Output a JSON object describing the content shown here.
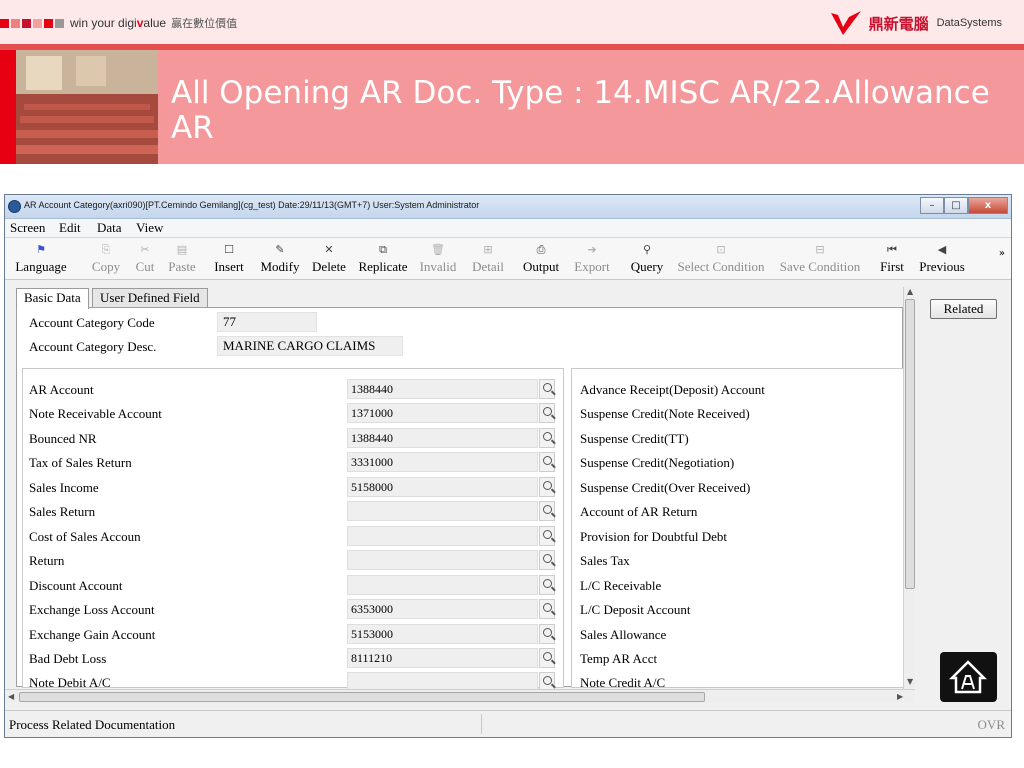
{
  "slide": {
    "tagline_en_1": "win your digi",
    "tagline_en_v": "v",
    "tagline_en_2": "alue",
    "tagline_zh": "贏在數位價值",
    "brand_zh": "鼎新電腦",
    "brand_en": "DataSystems",
    "title": "All Opening AR Doc. Type : 14.MISC AR/22.Allowance AR",
    "colors": {
      "banner": "#f4989b",
      "accent_red": "#e60012",
      "strip": "#e4504e"
    }
  },
  "window": {
    "title": "AR Account Category(axri090)[PT.Cemindo Gemilang](cg_test) Date:29/11/13(GMT+7) User:System Administrator",
    "controls": [
      "–",
      "□",
      "x"
    ]
  },
  "menu": [
    "Screen",
    "Edit",
    "Data",
    "View"
  ],
  "toolbar": [
    {
      "label": "Language",
      "icon": "flag-icon",
      "glyph": "⚑",
      "enabled": true
    },
    {
      "label": "Copy",
      "icon": "copy-icon",
      "glyph": "⎘",
      "enabled": false
    },
    {
      "label": "Cut",
      "icon": "cut-icon",
      "glyph": "✂",
      "enabled": false
    },
    {
      "label": "Paste",
      "icon": "paste-icon",
      "glyph": "▤",
      "enabled": false
    },
    {
      "label": "Insert",
      "icon": "new-document-icon",
      "glyph": "☐",
      "enabled": true
    },
    {
      "label": "Modify",
      "icon": "pencil-icon",
      "glyph": "✎",
      "enabled": true
    },
    {
      "label": "Delete",
      "icon": "delete-x-icon",
      "glyph": "✕",
      "enabled": true
    },
    {
      "label": "Replicate",
      "icon": "replicate-icon",
      "glyph": "⧉",
      "enabled": true
    },
    {
      "label": "Invalid",
      "icon": "trash-icon",
      "glyph": "🗑",
      "enabled": false
    },
    {
      "label": "Detail",
      "icon": "detail-icon",
      "glyph": "⊞",
      "enabled": false
    },
    {
      "label": "Output",
      "icon": "printer-icon",
      "glyph": "⎙",
      "enabled": true
    },
    {
      "label": "Export",
      "icon": "export-icon",
      "glyph": "➜",
      "enabled": false
    },
    {
      "label": "Query",
      "icon": "binoculars-icon",
      "glyph": "⚲",
      "enabled": true
    },
    {
      "label": "Select Condition",
      "icon": "select-condition-icon",
      "glyph": "⊡",
      "enabled": false
    },
    {
      "label": "Save Condition",
      "icon": "save-condition-icon",
      "glyph": "⊟",
      "enabled": false
    },
    {
      "label": "First",
      "icon": "first-record-icon",
      "glyph": "⏮",
      "enabled": true
    },
    {
      "label": "Previous",
      "icon": "previous-record-icon",
      "glyph": "◀",
      "enabled": true
    }
  ],
  "toolbar_more": "»",
  "tabs": [
    "Basic Data",
    "User Defined Field"
  ],
  "header": {
    "code_label": "Account Category Code",
    "code_value": "77",
    "desc_label": "Account Category Desc.",
    "desc_value": "MARINE CARGO CLAIMS"
  },
  "left_fields": [
    {
      "label": "AR Account",
      "value": "1388440"
    },
    {
      "label": "Note Receivable Account",
      "value": "1371000"
    },
    {
      "label": "Bounced NR",
      "value": "1388440"
    },
    {
      "label": "Tax of Sales Return",
      "value": "3331000"
    },
    {
      "label": "Sales Income",
      "value": "5158000"
    },
    {
      "label": "Sales Return",
      "value": ""
    },
    {
      "label": "Cost of Sales Accoun",
      "value": ""
    },
    {
      "label": "Return",
      "value": ""
    },
    {
      "label": "Discount Account",
      "value": ""
    },
    {
      "label": "Exchange Loss Account",
      "value": "6353000"
    },
    {
      "label": "Exchange Gain Account",
      "value": "5153000"
    },
    {
      "label": "Bad Debt Loss",
      "value": "8111210"
    },
    {
      "label": "Note Debit A/C",
      "value": ""
    }
  ],
  "right_fields": [
    "Advance Receipt(Deposit) Account",
    "Suspense Credit(Note Received)",
    "Suspense Credit(TT)",
    "Suspense Credit(Negotiation)",
    "Suspense Credit(Over Received)",
    "Account of AR Return",
    "Provision for Doubtful Debt",
    "Sales Tax",
    "L/C Receivable",
    "L/C Deposit Account",
    "Sales Allowance",
    "Temp AR Acct",
    "Note Credit A/C"
  ],
  "side": {
    "related_label": "Related"
  },
  "status": {
    "text": "Process Related Documentation",
    "mode": "OVR"
  }
}
